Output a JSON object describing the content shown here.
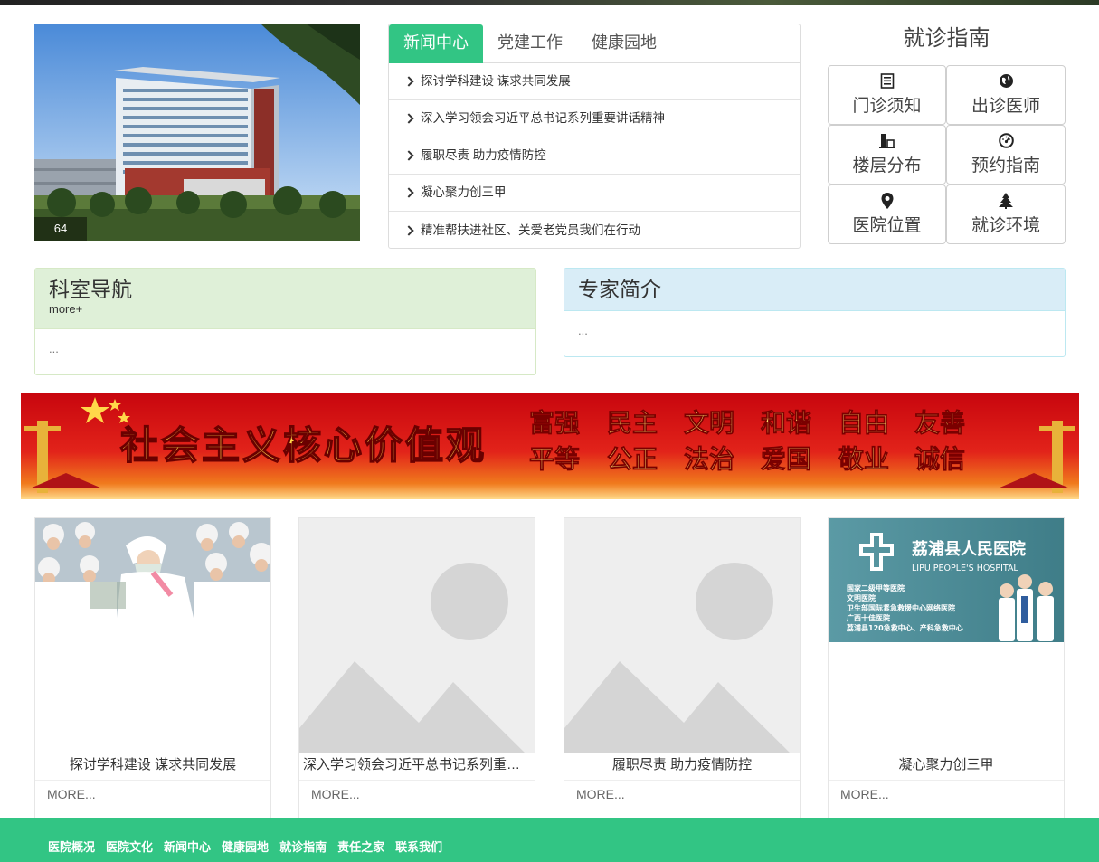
{
  "photo": {
    "caption": "64"
  },
  "news": {
    "tabs": [
      {
        "label": "新闻中心"
      },
      {
        "label": "党建工作"
      },
      {
        "label": "健康园地"
      }
    ],
    "items": [
      "探讨学科建设 谋求共同发展",
      "深入学习领会习近平总书记系列重要讲话精神",
      "履职尽责 助力疫情防控",
      "凝心聚力创三甲",
      "精准帮扶进社区、关爱老党员我们在行动"
    ]
  },
  "guide": {
    "title": "就诊指南",
    "items": [
      {
        "label": "门诊须知",
        "icon": "list-icon"
      },
      {
        "label": "出诊医师",
        "icon": "globe-icon"
      },
      {
        "label": "楼层分布",
        "icon": "building-icon"
      },
      {
        "label": "预约指南",
        "icon": "dashboard-icon"
      },
      {
        "label": "医院位置",
        "icon": "map-marker-icon"
      },
      {
        "label": "就诊环境",
        "icon": "tree-icon"
      }
    ]
  },
  "departments": {
    "title": "科室导航",
    "more": "more+",
    "body": "..."
  },
  "experts": {
    "title": "专家简介",
    "body": "..."
  },
  "banner": {
    "slogan": "社会主义核心价值观",
    "values_row1": [
      "富强",
      "民主",
      "文明",
      "和谐",
      "自由",
      "友善"
    ],
    "values_row2": [
      "平等",
      "公正",
      "法治",
      "爱国",
      "敬业",
      "诚信"
    ]
  },
  "cards": [
    {
      "title": "探讨学科建设 谋求共同发展",
      "more": "MORE..."
    },
    {
      "title": "深入学习领会习近平总书记系列重要讲话精神",
      "more": "MORE..."
    },
    {
      "title": "履职尽责 助力疫情防控",
      "more": "MORE..."
    },
    {
      "title": "凝心聚力创三甲",
      "more": "MORE..."
    }
  ],
  "hospital_logo": {
    "name": "荔浦县人民医院",
    "name_en": "LIPU PEOPLE'S HOSPITAL",
    "honors": [
      "国家二级甲等医院",
      "文明医院",
      "卫生部国际紧急救援中心网络医院",
      "广西十佳医院",
      "荔浦县120急救中心、产科急救中心"
    ]
  },
  "footer": {
    "links": [
      "医院概况",
      "医院文化",
      "新闻中心",
      "健康园地",
      "就诊指南",
      "责任之家",
      "联系我们"
    ]
  },
  "colors": {
    "accent": "#32c584",
    "banner_red": "#d8141b",
    "banner_gold": "#ffd84a"
  }
}
